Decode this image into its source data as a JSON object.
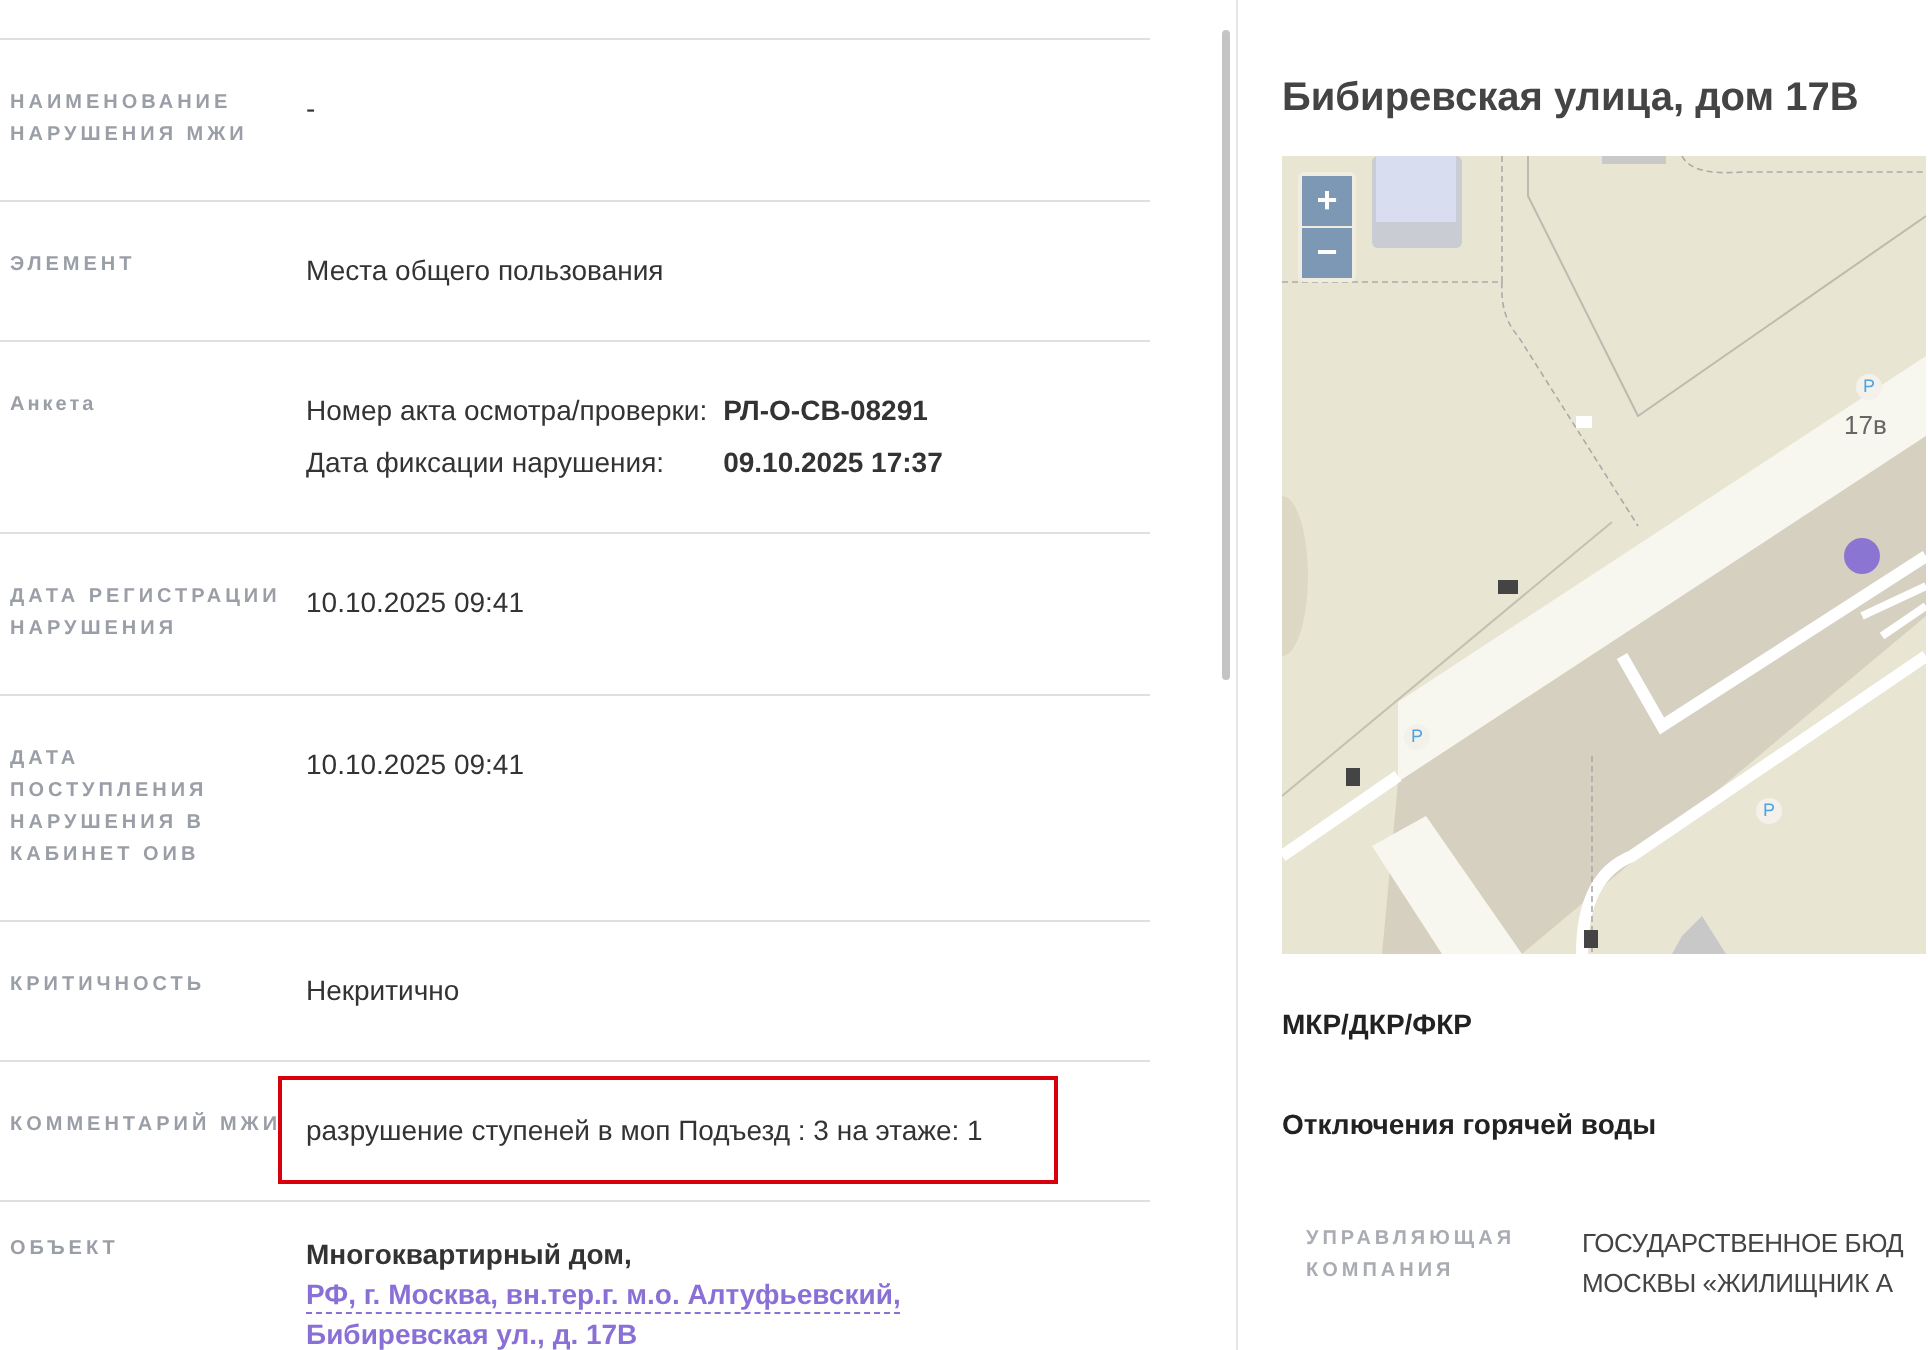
{
  "details": [
    {
      "kind": "text",
      "label": "НАИМЕНОВАНИЕ НАРУШЕНИЯ МЖИ",
      "uppercase": true,
      "value": "-",
      "highlighted": false
    },
    {
      "kind": "text",
      "label": "ЭЛЕМЕНТ",
      "uppercase": true,
      "value": "Места общего пользования",
      "highlighted": false
    },
    {
      "kind": "pairs",
      "label": "Анкета",
      "uppercase": false,
      "pairs": [
        {
          "name": "Номер акта осмотра/проверки:",
          "value": "РЛ-О-СВ-08291"
        },
        {
          "name": "Дата фиксации нарушения:",
          "value": "09.10.2025 17:37"
        }
      ],
      "highlighted": false
    },
    {
      "kind": "text",
      "label": "ДАТА РЕГИСТРАЦИИ НАРУШЕНИЯ",
      "uppercase": true,
      "value": "10.10.2025 09:41",
      "highlighted": false
    },
    {
      "kind": "text",
      "label": "ДАТА ПОСТУПЛЕНИЯ НАРУШЕНИЯ В КАБИНЕТ ОИВ",
      "uppercase": true,
      "value": "10.10.2025 09:41",
      "highlighted": false
    },
    {
      "kind": "text",
      "label": "КРИТИЧНОСТЬ",
      "uppercase": true,
      "value": "Некритично",
      "highlighted": false
    },
    {
      "kind": "text",
      "label": "КОММЕНТАРИЙ МЖИ",
      "uppercase": true,
      "value": "разрушение ступеней в моп Подъезд : 3 на этаже: 1",
      "highlighted": true
    },
    {
      "kind": "object",
      "label": "ОБЪЕКТ",
      "uppercase": true,
      "prefix": "Многоквартирный дом,",
      "link": "РФ, г. Москва, вн.тер.г. м.о. Алтуфьевский, Бибиревская ул., д. 17В",
      "highlighted": false
    }
  ],
  "side": {
    "title": "Бибиревская улица, дом 17В",
    "map": {
      "zoom_in": "+",
      "zoom_out": "−",
      "house_label": "17в",
      "parking": [
        "P",
        "P",
        "P"
      ]
    },
    "sections": [
      "МКР/ДКР/ФКР",
      "Отключения горячей воды"
    ],
    "company": {
      "label": "УПРАВЛЯЮЩАЯ КОМПАНИЯ",
      "lines": [
        "ГОСУДАРСТВЕННОЕ БЮД",
        "МОСКВЫ «ЖИЛИЩНИК А"
      ]
    }
  }
}
